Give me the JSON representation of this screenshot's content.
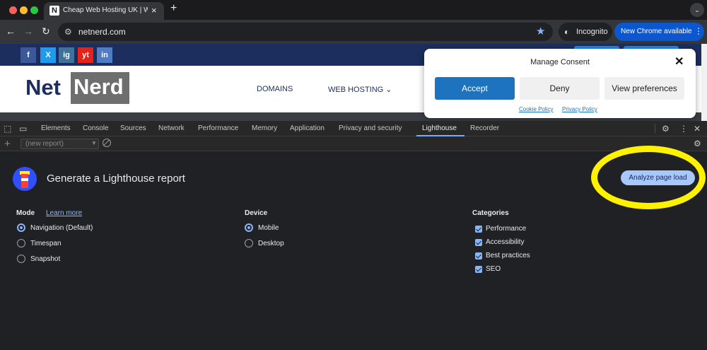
{
  "browser": {
    "tab_title": "Cheap Web Hosting UK | Web",
    "tab_favicon": "N",
    "url": "netnerd.com",
    "incognito_label": "Incognito",
    "update_label": "New Chrome available"
  },
  "site": {
    "logo_net": "Net",
    "logo_nerd": "Nerd",
    "social": [
      "f",
      "X",
      "ig",
      "yt",
      "in"
    ],
    "menu": [
      "DOMAINS",
      "WEB HOSTING ⌄"
    ]
  },
  "consent": {
    "title": "Manage Consent",
    "accept": "Accept",
    "deny": "Deny",
    "preferences": "View preferences",
    "cookie_policy": "Cookie Policy",
    "privacy_policy": "Privacy Policy"
  },
  "devtools": {
    "tabs": [
      "Elements",
      "Console",
      "Sources",
      "Network",
      "Performance",
      "Memory",
      "Application",
      "Privacy and security",
      "Lighthouse",
      "Recorder"
    ],
    "active_tab": "Lighthouse",
    "report_select": "(new report)",
    "lighthouse": {
      "title": "Generate a Lighthouse report",
      "analyze_button": "Analyze page load",
      "mode": {
        "label": "Mode",
        "learn_more": "Learn more",
        "options": [
          "Navigation (Default)",
          "Timespan",
          "Snapshot"
        ],
        "selected": "Navigation (Default)"
      },
      "device": {
        "label": "Device",
        "options": [
          "Mobile",
          "Desktop"
        ],
        "selected": "Mobile"
      },
      "categories": {
        "label": "Categories",
        "options": [
          "Performance",
          "Accessibility",
          "Best practices",
          "SEO"
        ]
      }
    }
  },
  "colors": {
    "accent": "#8ab4f8",
    "highlight": "#fef200",
    "site_navy": "#1c2e5e"
  }
}
